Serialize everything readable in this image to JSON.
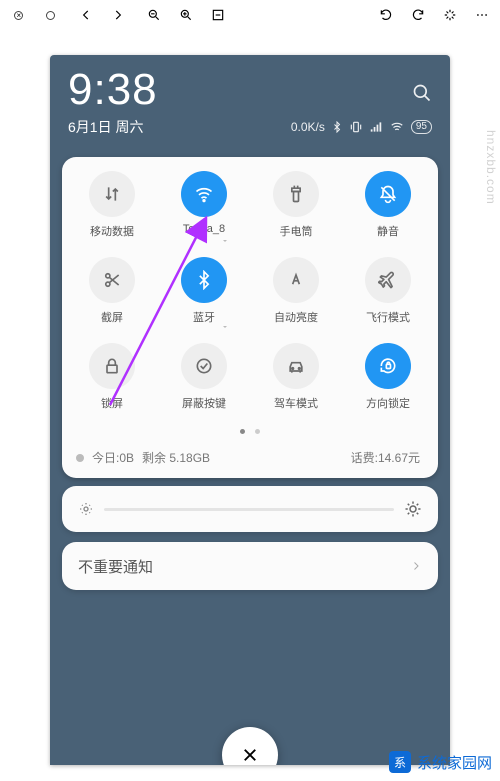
{
  "viewer": {
    "close": "close-icon",
    "collapse": "collapse-icon",
    "back": "back-icon",
    "forward": "forward-icon",
    "zoom_out": "zoom-out-icon",
    "zoom_in": "zoom-in-icon",
    "fit": "fit-icon",
    "rotate_ccw": "rotate-ccw-icon",
    "rotate_cw": "rotate-cw-icon",
    "sparkle": "sparkle-icon",
    "more": "more-icon"
  },
  "status": {
    "time": "9:38",
    "date": "6月1日 周六",
    "net_speed": "0.0K/s",
    "battery": "95"
  },
  "tiles": [
    {
      "key": "mobile-data",
      "label": "移动数据",
      "icon": "swap-vert-icon",
      "on": false,
      "chev": false
    },
    {
      "key": "wifi",
      "label": "Tenda_8",
      "icon": "wifi-icon",
      "on": true,
      "chev": true
    },
    {
      "key": "torch",
      "label": "手电筒",
      "icon": "torch-icon",
      "on": false,
      "chev": false
    },
    {
      "key": "mute",
      "label": "静音",
      "icon": "mute-icon",
      "on": true,
      "chev": false
    },
    {
      "key": "screenshot",
      "label": "截屏",
      "icon": "scissors-icon",
      "on": false,
      "chev": false
    },
    {
      "key": "bluetooth",
      "label": "蓝牙",
      "icon": "bluetooth-icon",
      "on": true,
      "chev": true
    },
    {
      "key": "auto-bright",
      "label": "自动亮度",
      "icon": "brightness-auto-icon",
      "on": false,
      "chev": false
    },
    {
      "key": "airplane",
      "label": "飞行模式",
      "icon": "airplane-icon",
      "on": false,
      "chev": false
    },
    {
      "key": "lock",
      "label": "锁屏",
      "icon": "lock-icon",
      "on": false,
      "chev": false
    },
    {
      "key": "nav-hide",
      "label": "屏蔽按键",
      "icon": "nav-hide-icon",
      "on": false,
      "chev": false
    },
    {
      "key": "driving",
      "label": "驾车模式",
      "icon": "car-icon",
      "on": false,
      "chev": false
    },
    {
      "key": "rotation-lock",
      "label": "方向锁定",
      "icon": "rotation-lock-icon",
      "on": true,
      "chev": false
    }
  ],
  "data_bar": {
    "today_label": "今日:0B",
    "remain_label": "剩余 5.18GB",
    "balance_label": "话费:14.67元"
  },
  "low_notif": {
    "label": "不重要通知"
  },
  "colors": {
    "accent": "#2196f3"
  },
  "watermarks": {
    "side": "hnzxbb.com",
    "logo_text": "系统家园网",
    "logo_sub": ""
  },
  "annotation": {
    "arrow_color": "#b030ff"
  }
}
